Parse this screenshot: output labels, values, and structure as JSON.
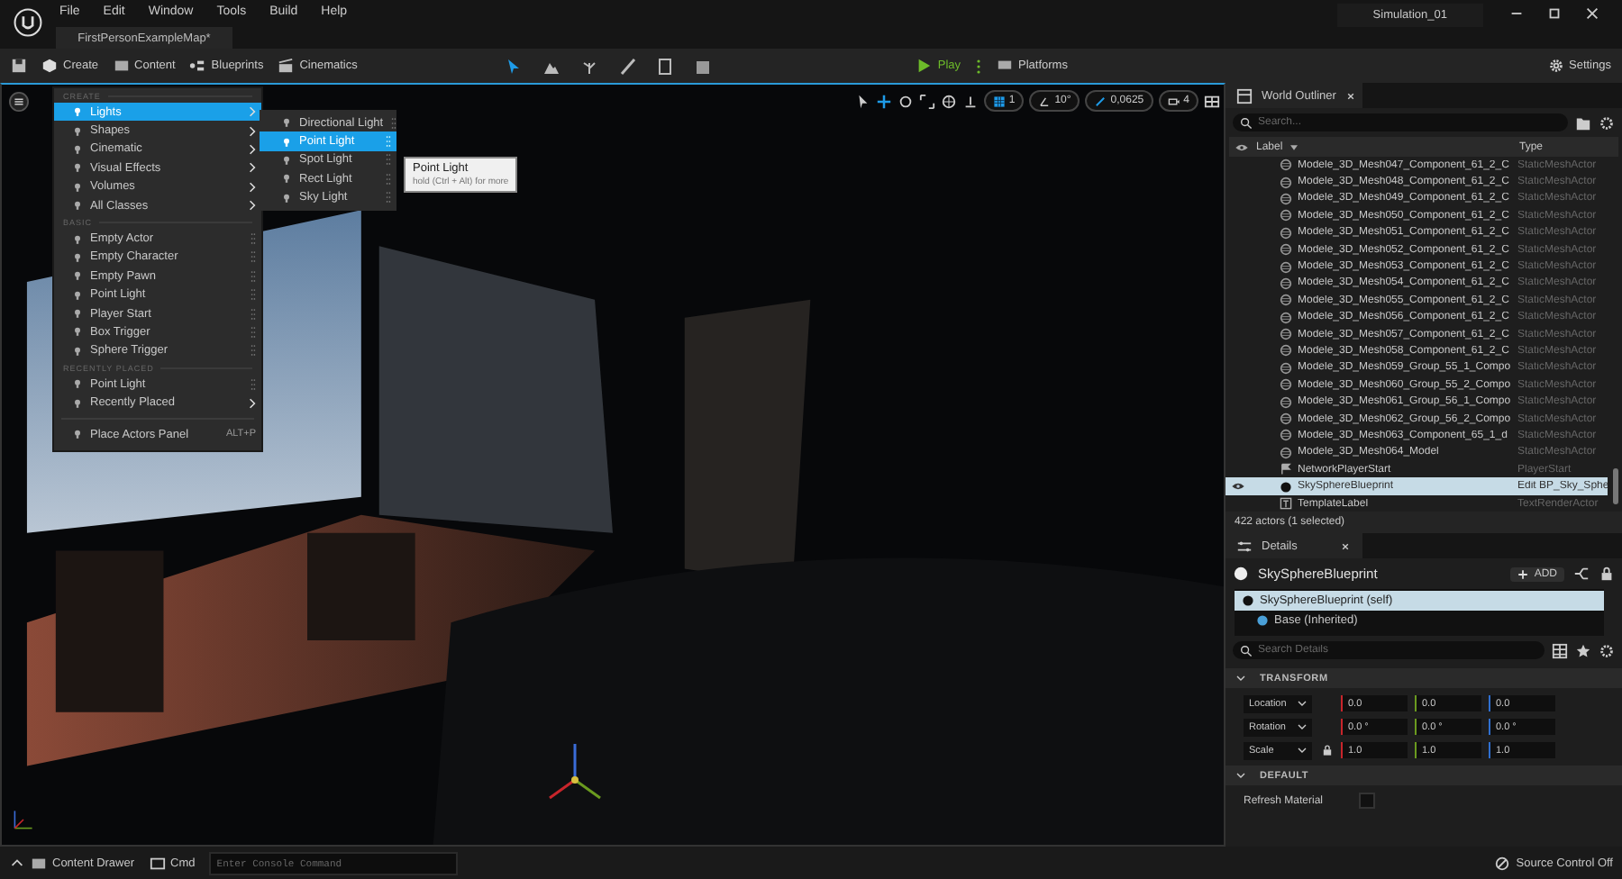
{
  "menu_bar": [
    "File",
    "Edit",
    "Window",
    "Tools",
    "Build",
    "Help"
  ],
  "document_tab": {
    "label": "FirstPersonExampleMap*"
  },
  "project_name": "Simulation_01",
  "toolbar": {
    "menus": [
      {
        "label": "Create",
        "kind": "create"
      },
      {
        "label": "Content",
        "kind": "content"
      },
      {
        "label": "Blueprints",
        "kind": "blueprints"
      },
      {
        "label": "Cinematics",
        "kind": "cinematics"
      }
    ],
    "play": "Play",
    "platforms": "Platforms",
    "settings": "Settings"
  },
  "viewport_toolbar": {
    "grid": "1",
    "angle": "10°",
    "scale": "0,0625",
    "camera_speed": "4"
  },
  "place_menu": {
    "sections": [
      {
        "header": "CREATE",
        "items": [
          {
            "label": "Lights",
            "kind": "submenu",
            "selected": true
          },
          {
            "label": "Shapes",
            "kind": "submenu",
            "selected": false
          },
          {
            "label": "Cinematic",
            "kind": "submenu",
            "selected": false
          },
          {
            "label": "Visual Effects",
            "kind": "submenu",
            "selected": false
          },
          {
            "label": "Volumes",
            "kind": "submenu",
            "selected": false
          },
          {
            "label": "All Classes",
            "kind": "submenu",
            "selected": false
          }
        ]
      },
      {
        "header": "BASIC",
        "items": [
          {
            "label": "Empty Actor",
            "kind": "drag",
            "selected": false
          },
          {
            "label": "Empty Character",
            "kind": "drag",
            "selected": false
          },
          {
            "label": "Empty Pawn",
            "kind": "drag",
            "selected": false
          },
          {
            "label": "Point Light",
            "kind": "drag",
            "selected": false
          },
          {
            "label": "Player Start",
            "kind": "drag",
            "selected": false
          },
          {
            "label": "Box Trigger",
            "kind": "drag",
            "selected": false
          },
          {
            "label": "Sphere Trigger",
            "kind": "drag",
            "selected": false
          }
        ]
      },
      {
        "header": "RECENTLY PLACED",
        "items": [
          {
            "label": "Point Light",
            "kind": "drag",
            "selected": false
          },
          {
            "label": "Recently Placed",
            "kind": "submenu",
            "selected": false
          }
        ]
      },
      {
        "items": [
          {
            "label": "Place Actors Panel",
            "kind": "shortcut",
            "shortcut": "ALT+P",
            "selected": false
          }
        ]
      }
    ]
  },
  "submenu": {
    "items": [
      {
        "label": "Directional Light",
        "selected": false
      },
      {
        "label": "Point Light",
        "selected": true
      },
      {
        "label": "Spot Light",
        "selected": false
      },
      {
        "label": "Rect Light",
        "selected": false
      },
      {
        "label": "Sky Light",
        "selected": false
      }
    ]
  },
  "tooltip": {
    "title": "Point Light",
    "hint": "hold (Ctrl + Alt) for more"
  },
  "outliner": {
    "title": "World Outliner",
    "search": {
      "placeholder": "Search..."
    },
    "columns": [
      "Label",
      "Type"
    ],
    "rows": [
      {
        "label": "Modele_3D_Mesh047_Component_61_2_C",
        "type": "StaticMeshActor",
        "kind": "mesh",
        "selected": false
      },
      {
        "label": "Modele_3D_Mesh048_Component_61_2_C",
        "type": "StaticMeshActor",
        "kind": "mesh",
        "selected": false
      },
      {
        "label": "Modele_3D_Mesh049_Component_61_2_C",
        "type": "StaticMeshActor",
        "kind": "mesh",
        "selected": false
      },
      {
        "label": "Modele_3D_Mesh050_Component_61_2_C",
        "type": "StaticMeshActor",
        "kind": "mesh",
        "selected": false
      },
      {
        "label": "Modele_3D_Mesh051_Component_61_2_C",
        "type": "StaticMeshActor",
        "kind": "mesh",
        "selected": false
      },
      {
        "label": "Modele_3D_Mesh052_Component_61_2_C",
        "type": "StaticMeshActor",
        "kind": "mesh",
        "selected": false
      },
      {
        "label": "Modele_3D_Mesh053_Component_61_2_C",
        "type": "StaticMeshActor",
        "kind": "mesh",
        "selected": false
      },
      {
        "label": "Modele_3D_Mesh054_Component_61_2_C",
        "type": "StaticMeshActor",
        "kind": "mesh",
        "selected": false
      },
      {
        "label": "Modele_3D_Mesh055_Component_61_2_C",
        "type": "StaticMeshActor",
        "kind": "mesh",
        "selected": false
      },
      {
        "label": "Modele_3D_Mesh056_Component_61_2_C",
        "type": "StaticMeshActor",
        "kind": "mesh",
        "selected": false
      },
      {
        "label": "Modele_3D_Mesh057_Component_61_2_C",
        "type": "StaticMeshActor",
        "kind": "mesh",
        "selected": false
      },
      {
        "label": "Modele_3D_Mesh058_Component_61_2_C",
        "type": "StaticMeshActor",
        "kind": "mesh",
        "selected": false
      },
      {
        "label": "Modele_3D_Mesh059_Group_55_1_Compo",
        "type": "StaticMeshActor",
        "kind": "mesh",
        "selected": false
      },
      {
        "label": "Modele_3D_Mesh060_Group_55_2_Compo",
        "type": "StaticMeshActor",
        "kind": "mesh",
        "selected": false
      },
      {
        "label": "Modele_3D_Mesh061_Group_56_1_Compo",
        "type": "StaticMeshActor",
        "kind": "mesh",
        "selected": false
      },
      {
        "label": "Modele_3D_Mesh062_Group_56_2_Compo",
        "type": "StaticMeshActor",
        "kind": "mesh",
        "selected": false
      },
      {
        "label": "Modele_3D_Mesh063_Component_65_1_d",
        "type": "StaticMeshActor",
        "kind": "mesh",
        "selected": false
      },
      {
        "label": "Modele_3D_Mesh064_Model",
        "type": "StaticMeshActor",
        "kind": "mesh",
        "selected": false
      },
      {
        "label": "NetworkPlayerStart",
        "type": "PlayerStart",
        "kind": "player_start",
        "selected": false
      },
      {
        "label": "SkySphereBlueprint",
        "type": "Edit BP_Sky_Sphe",
        "kind": "blueprint",
        "selected": true
      },
      {
        "label": "TemplateLabel",
        "type": "TextRenderActor",
        "kind": "text",
        "selected": false
      }
    ],
    "status": "422 actors (1 selected)"
  },
  "details": {
    "title": "Details",
    "actor": "SkySphereBlueprint",
    "add_button": "ADD",
    "components": [
      {
        "label": "SkySphereBlueprint (self)",
        "selected": true
      },
      {
        "label": "Base (Inherited)",
        "selected": false
      }
    ],
    "search": {
      "placeholder": "Search Details"
    },
    "sections": [
      {
        "header": "TRANSFORM",
        "properties": [
          {
            "label": "Location",
            "kind": "vector",
            "locked": false,
            "values": [
              "0.0",
              "0.0",
              "0.0"
            ]
          },
          {
            "label": "Rotation",
            "kind": "vector",
            "locked": false,
            "values": [
              "0.0 °",
              "0.0 °",
              "0.0 °"
            ]
          },
          {
            "label": "Scale",
            "kind": "vector",
            "locked": true,
            "values": [
              "1.0",
              "1.0",
              "1.0"
            ]
          }
        ]
      },
      {
        "header": "DEFAULT",
        "properties": [
          {
            "label": "Refresh Material",
            "kind": "checkbox",
            "checked": false
          }
        ]
      }
    ]
  },
  "status_bar": {
    "content_drawer": "Content Drawer",
    "cmd": "Cmd",
    "console": {
      "placeholder": "Enter Console Command"
    },
    "source_control": "Source Control Off"
  }
}
